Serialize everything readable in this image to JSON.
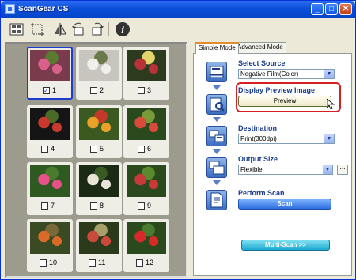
{
  "window": {
    "title": "ScanGear CS",
    "minimize": "_",
    "maximize": "□",
    "close": "✕"
  },
  "toolbar": {
    "icons": [
      "thumbnail-icon",
      "crop-icon",
      "mirror-icon",
      "rotate-left-icon",
      "rotate-right-icon",
      "info-icon"
    ]
  },
  "thumbnails": [
    {
      "num": "1",
      "checked": true,
      "colors": [
        "#7a3c4d",
        "#d9608a",
        "#5a7a2f"
      ]
    },
    {
      "num": "2",
      "checked": false,
      "colors": [
        "#c8c4be",
        "#f0efea",
        "#6b7a4a"
      ]
    },
    {
      "num": "3",
      "checked": false,
      "colors": [
        "#2c3a1d",
        "#b8323a",
        "#e2d36a"
      ]
    },
    {
      "num": "4",
      "checked": false,
      "colors": [
        "#151515",
        "#c83a2e",
        "#4a6a28"
      ]
    },
    {
      "num": "5",
      "checked": false,
      "colors": [
        "#3a5a22",
        "#e8a22a",
        "#c43a28"
      ]
    },
    {
      "num": "6",
      "checked": false,
      "colors": [
        "#2a4a1e",
        "#d84a3a",
        "#7a9a3a"
      ]
    },
    {
      "num": "7",
      "checked": false,
      "colors": [
        "#2e5a22",
        "#e8508a",
        "#4a7a2e"
      ]
    },
    {
      "num": "8",
      "checked": false,
      "colors": [
        "#1a2a14",
        "#e8e4d8",
        "#3a5a24"
      ]
    },
    {
      "num": "9",
      "checked": false,
      "colors": [
        "#2a4a1e",
        "#c83a3a",
        "#5a8a2e"
      ]
    },
    {
      "num": "10",
      "checked": false,
      "colors": [
        "#3a4a22",
        "#d86a2a",
        "#7a6a3a"
      ]
    },
    {
      "num": "11",
      "checked": false,
      "colors": [
        "#2a3a1a",
        "#c84a3a",
        "#a8a06a"
      ]
    },
    {
      "num": "12",
      "checked": false,
      "colors": [
        "#2a4a1e",
        "#d82a2a",
        "#4a7a2e"
      ]
    }
  ],
  "tabs": [
    {
      "label": "Simple Mode"
    },
    {
      "label": "Advanced Mode"
    }
  ],
  "steps": {
    "select_source": {
      "label": "Select Source",
      "value": "Negative Film(Color)"
    },
    "display_preview": {
      "label": "Display Preview Image",
      "button": "Preview"
    },
    "destination": {
      "label": "Destination",
      "value": "Print(300dpi)"
    },
    "output_size": {
      "label": "Output Size",
      "value": "Flexible"
    },
    "perform_scan": {
      "label": "Perform Scan",
      "button": "Scan"
    }
  },
  "multi_scan": "Multi-Scan >>",
  "colors": {
    "highlight": "#d51f22",
    "titlebar": "#0a4fd8",
    "selection": "#1c3bd0"
  }
}
